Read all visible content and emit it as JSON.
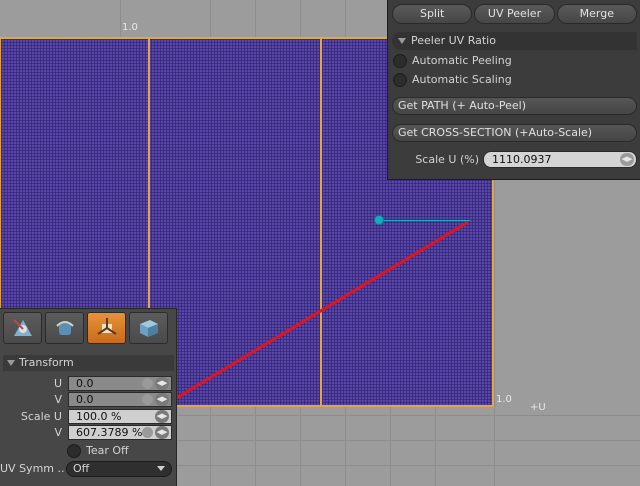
{
  "viewport": {
    "tick_top": "1.0",
    "tick_right": "1.0",
    "axis_u": "+U"
  },
  "peeler_panel": {
    "buttons": [
      "Split",
      "UV Peeler",
      "Merge"
    ],
    "section_title": "Peeler UV Ratio",
    "auto_peeling": "Automatic Peeling",
    "auto_scaling": "Automatic Scaling",
    "get_path": "Get PATH (+ Auto-Peel)",
    "get_cross_section": "Get CROSS-SECTION (+Auto-Scale)",
    "scale_u_label": "Scale U (%)",
    "scale_u_value": "1110.0937"
  },
  "tool_panel": {
    "icons": [
      "move-tool-icon",
      "rotate-tool-icon",
      "transform-tool-icon",
      "scale-tool-icon"
    ],
    "active_icon_index": 2,
    "transform_title": "Transform",
    "u_label": "U",
    "u_value": "0.0",
    "v_label": "V",
    "v_value": "0.0",
    "scale_u_label": "Scale U",
    "scale_u_value": "100.0 %",
    "scale_v_label": "V",
    "scale_v_value": "607.3789 %",
    "tear_off": "Tear Off",
    "uv_symm_label": "UV Symm ...",
    "uv_symm_value": "Off"
  },
  "colors": {
    "uv_fill": "#5a46a6",
    "seam": "#e2a547",
    "pin": "#18a8c0",
    "arrow": "#e0141c",
    "active_tool": "#e8913a"
  }
}
